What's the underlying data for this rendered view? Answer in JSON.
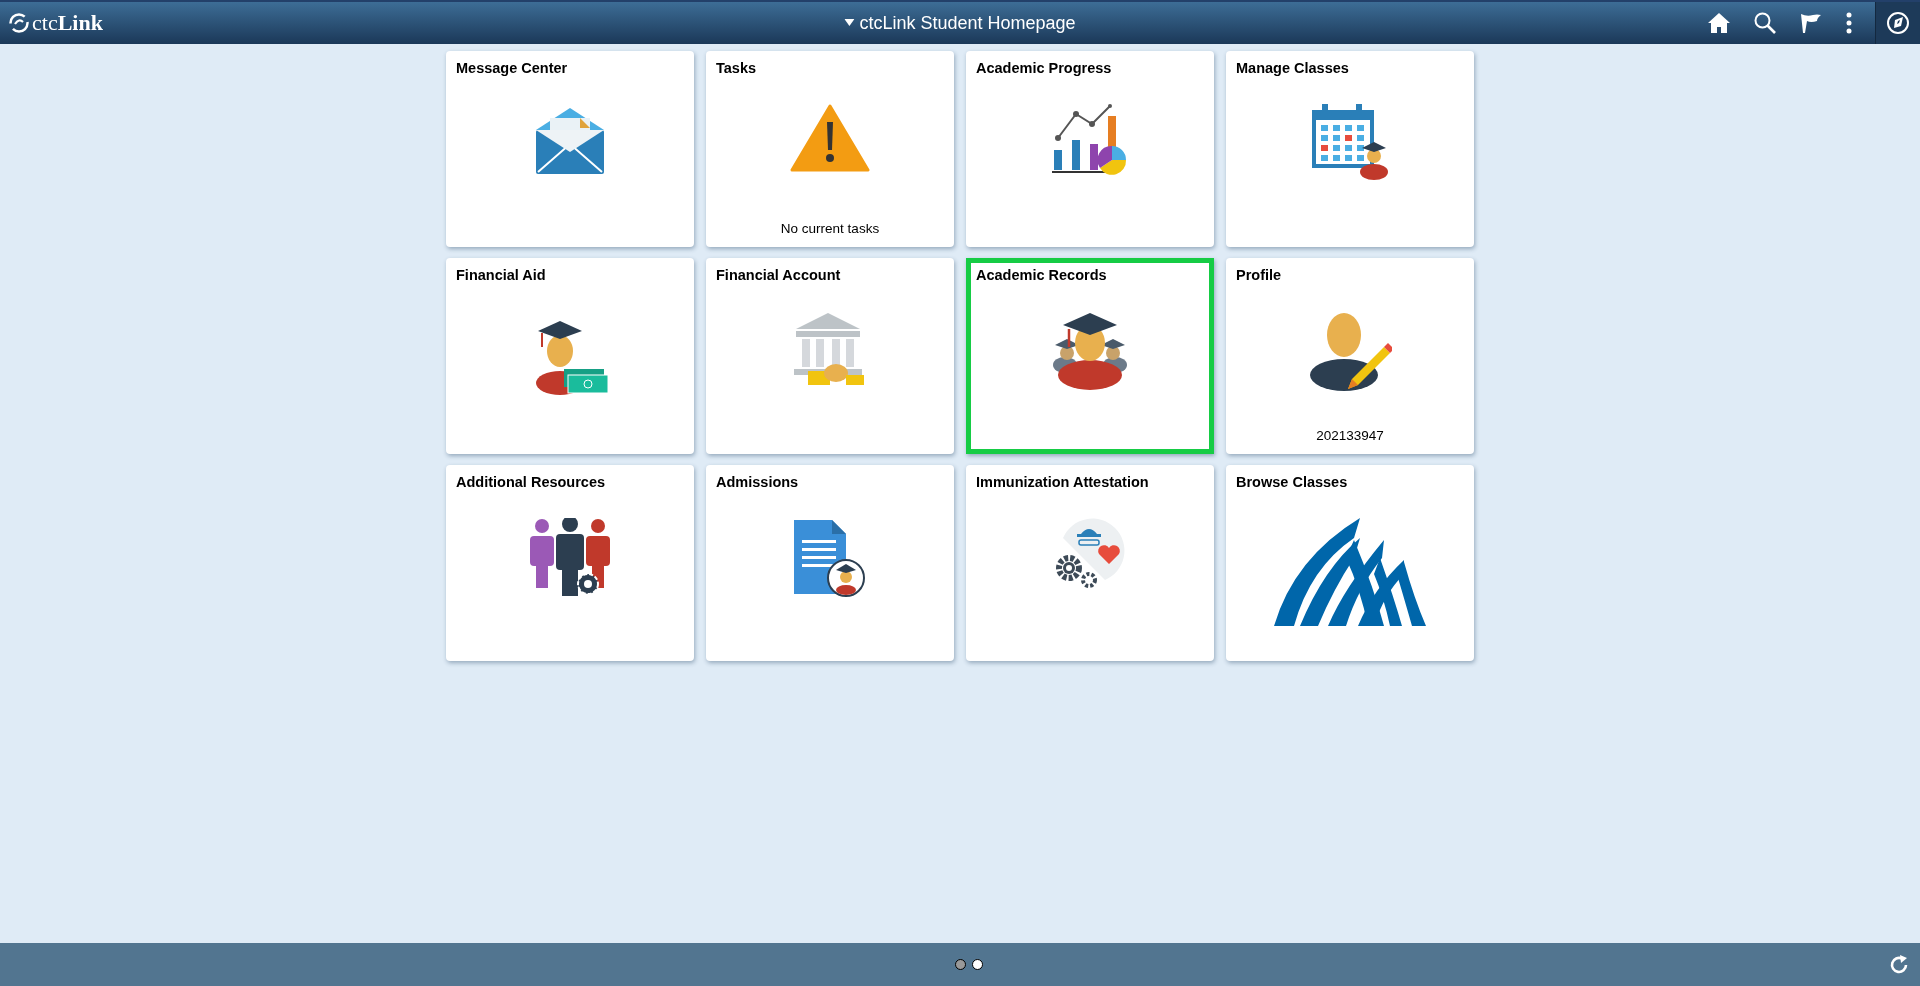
{
  "header": {
    "logo": "ctc**Link**",
    "title": "ctcLink Student Homepage"
  },
  "tiles": [
    {
      "title": "Message Center",
      "kind": "mail",
      "selected": false
    },
    {
      "title": "Tasks",
      "kind": "warning",
      "note": "No current tasks",
      "selected": false
    },
    {
      "title": "Academic Progress",
      "kind": "progress",
      "selected": false
    },
    {
      "title": "Manage Classes",
      "kind": "calendar",
      "selected": false
    },
    {
      "title": "Financial Aid",
      "kind": "aid",
      "selected": false
    },
    {
      "title": "Financial Account",
      "kind": "bank",
      "selected": false
    },
    {
      "title": "Academic Records",
      "kind": "records",
      "selected": true
    },
    {
      "title": "Profile",
      "kind": "profile",
      "note": "202133947",
      "selected": false
    },
    {
      "title": "Additional Resources",
      "kind": "people",
      "selected": false
    },
    {
      "title": "Admissions",
      "kind": "document",
      "selected": false
    },
    {
      "title": "Immunization Attestation",
      "kind": "health",
      "selected": false
    },
    {
      "title": "Browse Classes",
      "kind": "arches",
      "selected": false
    }
  ],
  "pages": [
    {
      "selected": true
    },
    {
      "selected": false
    }
  ]
}
